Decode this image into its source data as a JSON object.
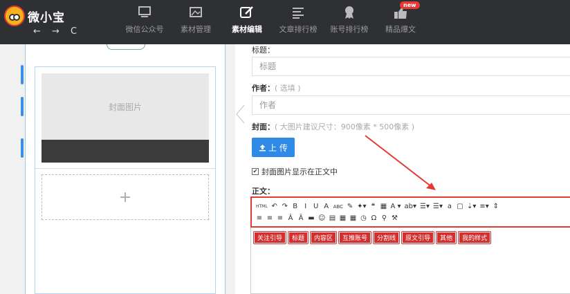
{
  "app": {
    "title": "微小宝",
    "nav_arrows": "← → C"
  },
  "nav": [
    {
      "label": "微信公众号",
      "icon": "monitor-icon",
      "active": false,
      "badge": ""
    },
    {
      "label": "素材管理",
      "icon": "image-icon",
      "active": false,
      "badge": ""
    },
    {
      "label": "素材编辑",
      "icon": "edit-icon",
      "active": true,
      "badge": ""
    },
    {
      "label": "文章排行榜",
      "icon": "list-icon",
      "active": false,
      "badge": ""
    },
    {
      "label": "账号排行榜",
      "icon": "award-icon",
      "active": false,
      "badge": ""
    },
    {
      "label": "精品爆文",
      "icon": "thumbs-up-icon",
      "active": false,
      "badge": "new"
    }
  ],
  "preview": {
    "cover_label": "封面图片",
    "add_symbol": "+"
  },
  "form": {
    "title_label": "标题：",
    "title_placeholder": "标题",
    "author_label": "作者：",
    "author_hint": "( 选填 )",
    "author_placeholder": "作者",
    "cover_label": "封面：",
    "cover_hint": "( 大图片建议尺寸：900像素 * 500像素 )",
    "upload_label": "上 传",
    "show_cover_label": "封面图片显示在正文中",
    "show_cover_checked": true,
    "body_label": "正文："
  },
  "toolbar": {
    "row1": [
      "HTML",
      "↶",
      "↷",
      "B",
      "I",
      "U",
      "A",
      "ABC",
      "✎",
      "✦▾",
      "❝",
      "▦",
      "A ▾",
      "ab▾",
      "☰▾",
      "☰▾",
      "a",
      "▢",
      "⇣▾",
      "≡▾",
      "⇕"
    ],
    "row2": [
      "≡",
      "≡",
      "≡",
      "Â",
      "Â",
      "▬",
      "☺",
      "▤",
      "▦",
      "▦",
      "◷",
      "Ω",
      "⚲",
      "⚒"
    ]
  },
  "tags": [
    "关注引导",
    "标题",
    "内容区",
    "互推账号",
    "分割线",
    "原文引导",
    "其他",
    "我的样式"
  ],
  "colors": {
    "topbar": "#2f3033",
    "accent": "#2e8ae6",
    "highlight": "#e53935"
  }
}
